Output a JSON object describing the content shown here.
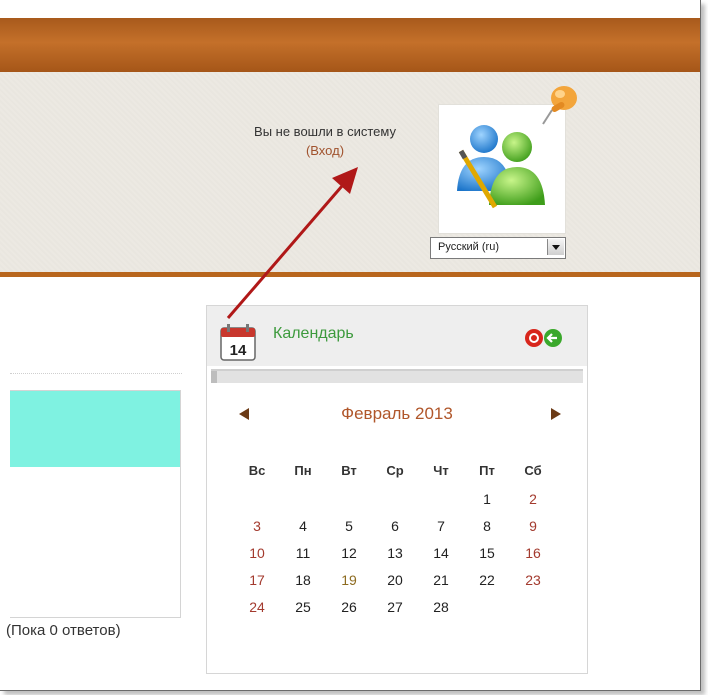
{
  "header": {
    "login_text": "Вы не вошли в систему",
    "login_link": "(Вход)",
    "language_select": "Русский (ru)"
  },
  "colors": {
    "header_band": "#b36121",
    "calendar_title": "#3d9a3d",
    "month": "#b0562a",
    "weekend": "#a33a2e",
    "teal_bar": "#7ff2e1"
  },
  "left_panel": {
    "replies": "(Пока 0 ответов)"
  },
  "calendar": {
    "title": "Календарь",
    "icon_day": "14",
    "month": "Февраль 2013",
    "weekdays": [
      "Вс",
      "Пн",
      "Вт",
      "Ср",
      "Чт",
      "Пт",
      "Сб"
    ],
    "weeks": [
      [
        "",
        "",
        "",
        "",
        "",
        "1",
        "2"
      ],
      [
        "3",
        "4",
        "5",
        "6",
        "7",
        "8",
        "9"
      ],
      [
        "10",
        "11",
        "12",
        "13",
        "14",
        "15",
        "16"
      ],
      [
        "17",
        "18",
        "19",
        "20",
        "21",
        "22",
        "23"
      ],
      [
        "24",
        "25",
        "26",
        "27",
        "28",
        "",
        ""
      ]
    ],
    "icons": [
      "calendar-icon",
      "hide-icon",
      "move-icon",
      "prev-month-icon",
      "next-month-icon"
    ]
  }
}
